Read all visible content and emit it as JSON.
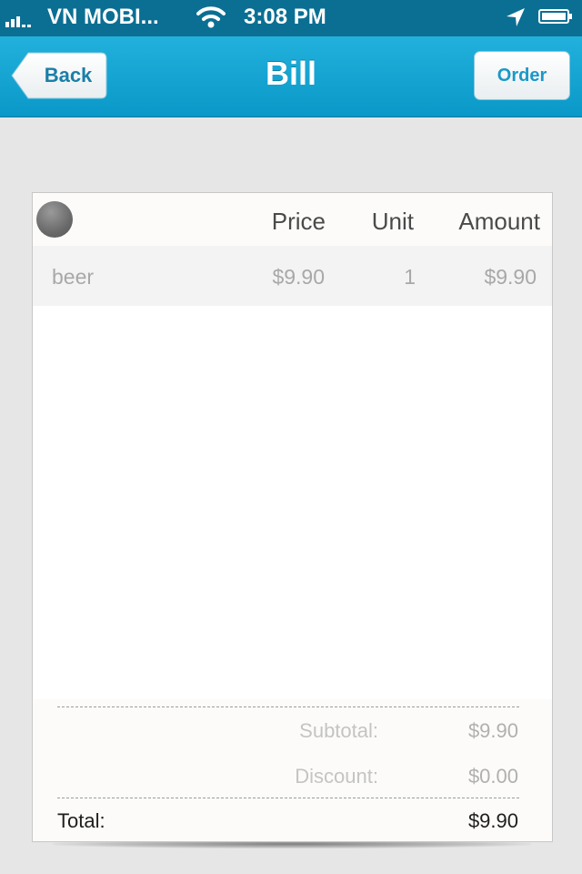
{
  "status_bar": {
    "carrier": "VN MOBI...",
    "time": "3:08 PM",
    "icons": [
      "signal-icon",
      "wifi-icon",
      "location-arrow-icon",
      "battery-icon"
    ]
  },
  "nav": {
    "title": "Bill",
    "back_label": "Back",
    "order_label": "Order"
  },
  "bill": {
    "columns": {
      "price": "Price",
      "unit": "Unit",
      "amount": "Amount"
    },
    "items": [
      {
        "name": "beer",
        "price": "$9.90",
        "unit": "1",
        "amount": "$9.90"
      }
    ],
    "summary": {
      "subtotal_label": "Subtotal:",
      "subtotal_value": "$9.90",
      "discount_label": "Discount:",
      "discount_value": "$0.00",
      "total_label": "Total:",
      "total_value": "$9.90"
    }
  },
  "colors": {
    "status_bar": "#0b6f93",
    "nav_bar": "#12a4d4",
    "accent_text": "#1a98c8",
    "background": "#e6e6e6"
  }
}
